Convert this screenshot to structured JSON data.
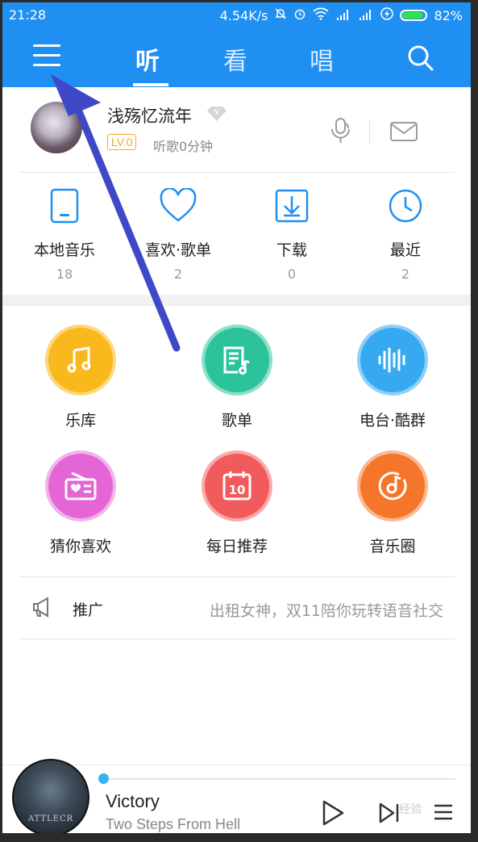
{
  "status_bar": {
    "time": "21:28",
    "net_speed": "4.54K/s",
    "battery": "82%"
  },
  "nav": {
    "tabs": [
      {
        "label": "听",
        "active": true
      },
      {
        "label": "看",
        "active": false
      },
      {
        "label": "唱",
        "active": false
      }
    ],
    "accent": "#1f8ff2"
  },
  "profile": {
    "username": "浅殇忆流年",
    "level": "LV.0",
    "listen_time": "听歌0分钟"
  },
  "quick_access": [
    {
      "label": "本地音乐",
      "count": "18",
      "icon": "phone-icon"
    },
    {
      "label": "喜欢·歌单",
      "count": "2",
      "icon": "heart-icon"
    },
    {
      "label": "下载",
      "count": "0",
      "icon": "download-icon"
    },
    {
      "label": "最近",
      "count": "2",
      "icon": "clock-icon"
    }
  ],
  "features": [
    {
      "label": "乐库",
      "color": "#f9b81b",
      "icon": "music-note-icon"
    },
    {
      "label": "歌单",
      "color": "#2cc29b",
      "icon": "songlist-icon"
    },
    {
      "label": "电台·酷群",
      "color": "#36aaf0",
      "icon": "soundwave-icon"
    },
    {
      "label": "猜你喜欢",
      "color": "#e466d6",
      "icon": "radio-icon"
    },
    {
      "label": "每日推荐",
      "color": "#f25b5b",
      "icon": "calendar-icon",
      "badge": "10"
    },
    {
      "label": "音乐圈",
      "color": "#f5762a",
      "icon": "disc-icon"
    }
  ],
  "promo": {
    "label": "推广",
    "text": "出租女神，双11陪你玩转语音社交"
  },
  "player": {
    "song": "Victory",
    "artist": "Two Steps From Hell",
    "cover_text": "ATTLECR",
    "progress": 0.0,
    "watermark": "经验"
  }
}
